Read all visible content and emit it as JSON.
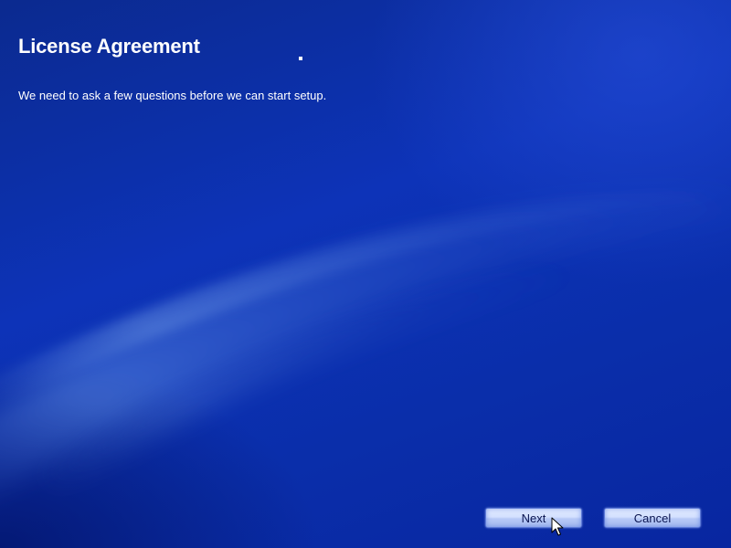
{
  "page": {
    "title": "License Agreement",
    "subtitle": "We need to ask a few questions before we can start setup."
  },
  "buttons": {
    "next_label": "Next",
    "cancel_label": "Cancel"
  },
  "colors": {
    "background": "#0a2aa6",
    "text": "#ffffff",
    "button_text": "#0a1450"
  },
  "icons": {
    "cursor": "arrow-cursor-icon"
  }
}
